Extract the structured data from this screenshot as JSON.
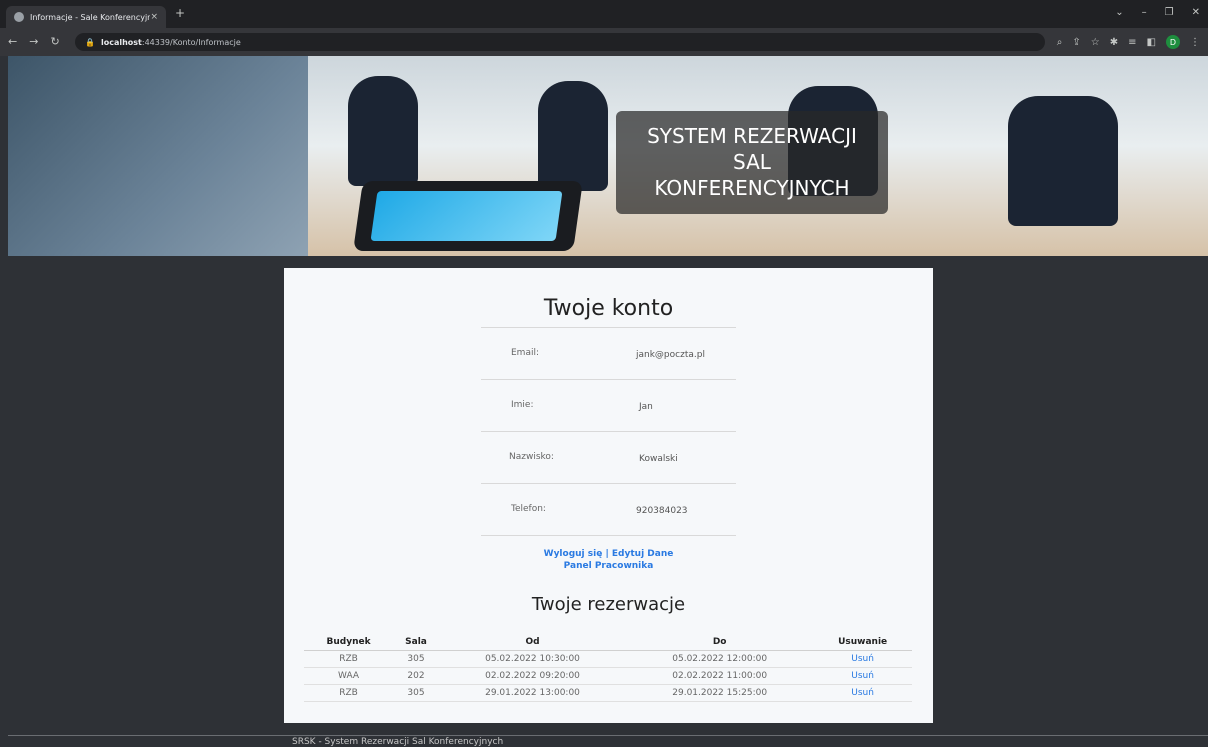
{
  "browser": {
    "tab_title": "Informacje - Sale Konferencyjne",
    "tab_close": "×",
    "new_tab": "+",
    "url_host": "localhost",
    "url_rest": ":44339/Konto/Informacje",
    "profile_initial": "D"
  },
  "header": {
    "title_line1": "SYSTEM REZERWACJI",
    "title_line2": "SAL",
    "title_line3": "KONFERENCYJNYCH"
  },
  "account": {
    "title": "Twoje konto",
    "rows": [
      {
        "label": "Email:",
        "value": "jank@poczta.pl"
      },
      {
        "label": "Imie:",
        "value": "Jan"
      },
      {
        "label": "Nazwisko:",
        "value": "Kowalski"
      },
      {
        "label": "Telefon:",
        "value": "920384023"
      }
    ],
    "links": {
      "logout": "Wyloguj się",
      "separator": "|",
      "edit": "Edytuj Dane",
      "panel": "Panel Pracownika"
    }
  },
  "reservations": {
    "title": "Twoje rezerwacje",
    "headers": [
      "Budynek",
      "Sala",
      "Od",
      "Do",
      "Usuwanie"
    ],
    "rows": [
      {
        "building": "RZB",
        "room": "305",
        "from": "05.02.2022 10:30:00",
        "to": "05.02.2022 12:00:00",
        "action": "Usuń"
      },
      {
        "building": "WAA",
        "room": "202",
        "from": "02.02.2022 09:20:00",
        "to": "02.02.2022 11:00:00",
        "action": "Usuń"
      },
      {
        "building": "RZB",
        "room": "305",
        "from": "29.01.2022 13:00:00",
        "to": "29.01.2022 15:25:00",
        "action": "Usuń"
      }
    ]
  },
  "footer": {
    "text": "SRSK - System Rezerwacji Sal Konferencyjnych"
  }
}
